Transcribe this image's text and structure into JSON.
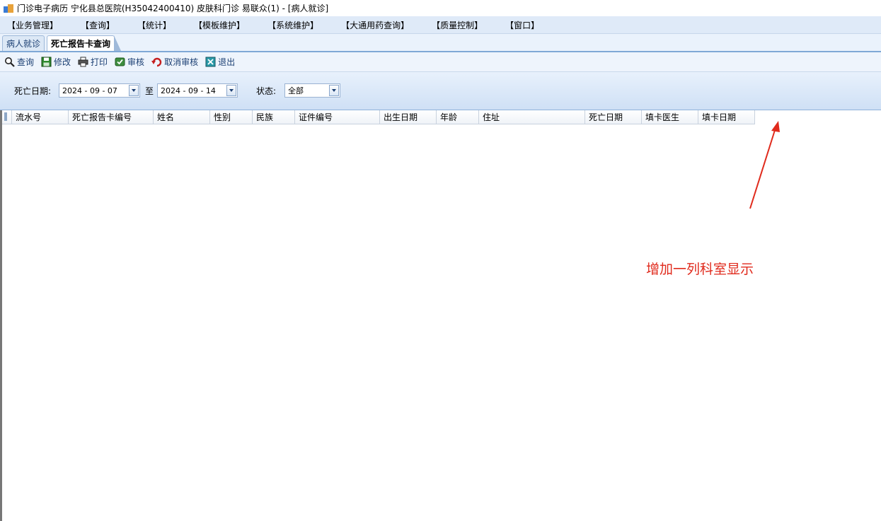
{
  "window": {
    "title": "门诊电子病历  宁化县总医院(H35042400410)  皮肤科门诊  易联众(1) - [病人就诊]"
  },
  "menu": {
    "items": [
      "【业务管理】",
      "【查询】",
      "【统计】",
      "【模板维护】",
      "【系统维护】",
      "【大通用药查询】",
      "【质量控制】",
      "【窗口】"
    ]
  },
  "tabs": [
    {
      "label": "病人就诊",
      "active": false
    },
    {
      "label": "死亡报告卡查询",
      "active": true
    }
  ],
  "toolbar": {
    "query": "查询",
    "edit": "修改",
    "print": "打印",
    "audit": "审核",
    "cancel_audit": "取消审核",
    "exit": "退出"
  },
  "filters": {
    "death_date_label": "死亡日期:",
    "date_from": "2024 - 09 - 07",
    "to_label": "至",
    "date_to": "2024 - 09 - 14",
    "status_label": "状态:",
    "status_value": "全部"
  },
  "table": {
    "columns": [
      "流水号",
      "死亡报告卡编号",
      "姓名",
      "性别",
      "民族",
      "证件编号",
      "出生日期",
      "年龄",
      "住址",
      "死亡日期",
      "填卡医生",
      "填卡日期"
    ],
    "rows": []
  },
  "annotation": {
    "text": "增加一列科室显示",
    "color": "#e02a1c"
  },
  "colors": {
    "menu_bg": "#dfeaf8",
    "filter_bg": "#cfe0f5",
    "accent_text": "#1b3f73"
  }
}
